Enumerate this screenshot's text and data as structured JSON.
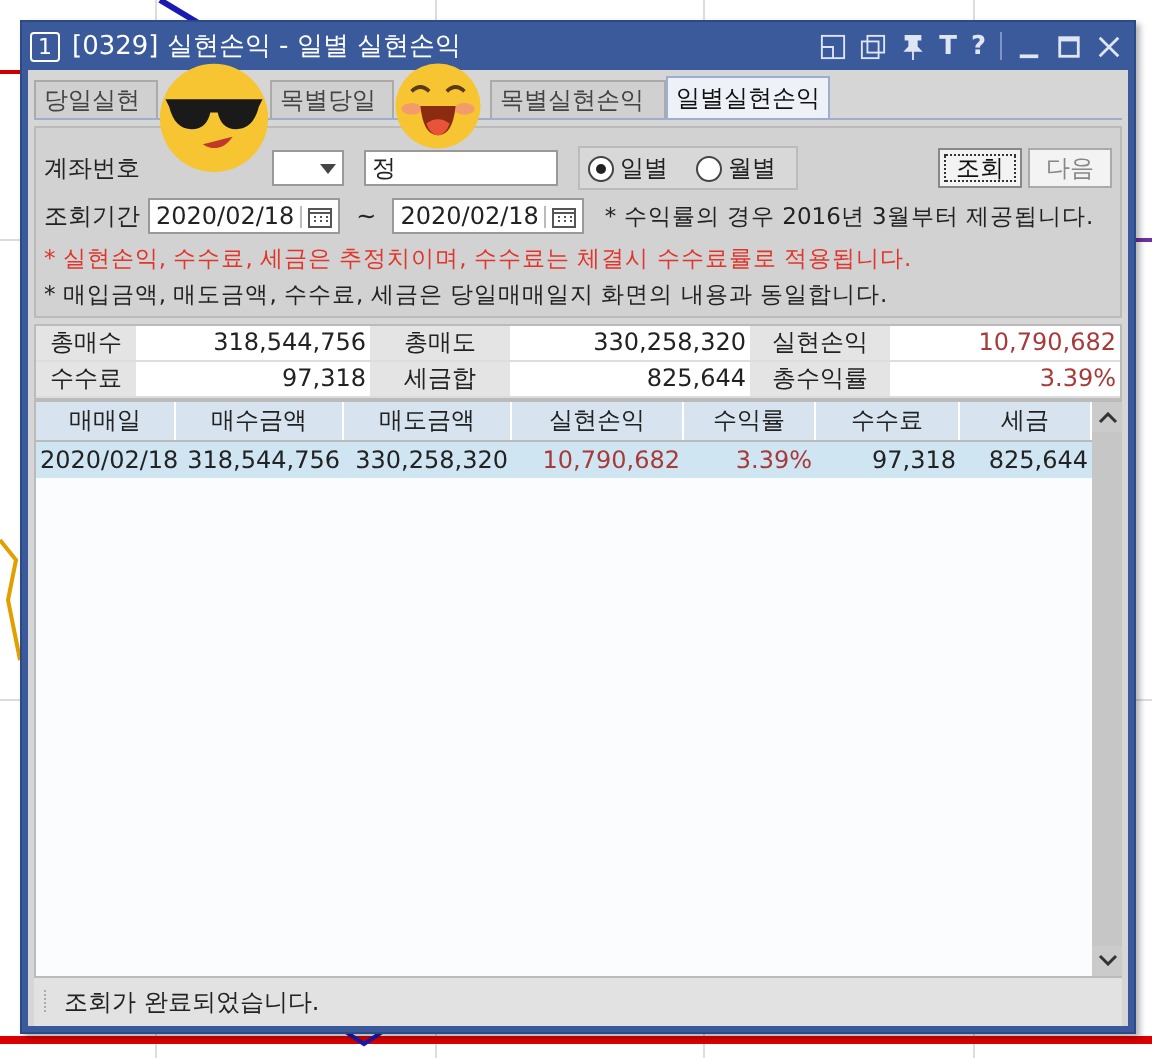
{
  "window": {
    "number": "1",
    "title": "[0329] 실현손익 - 일별 실현손익",
    "glyphs": [
      "T",
      "?"
    ]
  },
  "tabs": [
    {
      "label": "당일실현",
      "selected": false
    },
    {
      "label": "목별당일",
      "selected": false
    },
    {
      "label": "목별실현손익",
      "selected": false
    },
    {
      "label": "일별실현손익",
      "selected": true
    }
  ],
  "form": {
    "account_label": "계좌번호",
    "account_name": "정",
    "period_label": "조회기간",
    "from": "2020/02/18",
    "separator": "~",
    "to": "2020/02/18",
    "note": "* 수익률의 경우 2016년 3월부터 제공됩니다.",
    "modes": [
      {
        "label": "일별",
        "selected": true
      },
      {
        "label": "월별",
        "selected": false
      }
    ],
    "buttons": [
      {
        "label": "조회",
        "disabled": false
      },
      {
        "label": "다음",
        "disabled": true
      }
    ]
  },
  "notices": [
    {
      "text": "* 실현손익, 수수료, 세금은 추정치이며, 수수료는 체결시 수수료률로 적용됩니다.",
      "kind": "warning"
    },
    {
      "text": "* 매입금액, 매도금액, 수수료, 세금은 당일매매일지 화면의 내용과 동일합니다.",
      "kind": "info"
    }
  ],
  "summary": [
    [
      {
        "label": "총매수",
        "value": "318,544,756",
        "kind": "amount"
      },
      {
        "label": "총매도",
        "value": "330,258,320",
        "kind": "amount"
      },
      {
        "label": "실현손익",
        "value": "10,790,682",
        "kind": "profit"
      }
    ],
    [
      {
        "label": "수수료",
        "value": "97,318",
        "kind": "amount"
      },
      {
        "label": "세금합",
        "value": "825,644",
        "kind": "amount"
      },
      {
        "label": "총수익률",
        "value": "3.39%",
        "kind": "profit"
      }
    ]
  ],
  "table": {
    "columns": [
      {
        "label": "매매일",
        "kind": "date"
      },
      {
        "label": "매수금액",
        "kind": "amount"
      },
      {
        "label": "매도금액",
        "kind": "amount"
      },
      {
        "label": "실현손익",
        "kind": "profit"
      },
      {
        "label": "수익률",
        "kind": "profit"
      },
      {
        "label": "수수료",
        "kind": "amount"
      },
      {
        "label": "세금",
        "kind": "amount"
      }
    ],
    "rows": [
      {
        "selected": true,
        "cells": [
          "2020/02/18",
          "318,544,756",
          "330,258,320",
          "10,790,682",
          "3.39%",
          "97,318",
          "825,644"
        ]
      }
    ]
  },
  "status_bar": "조회가 완료되었습니다."
}
